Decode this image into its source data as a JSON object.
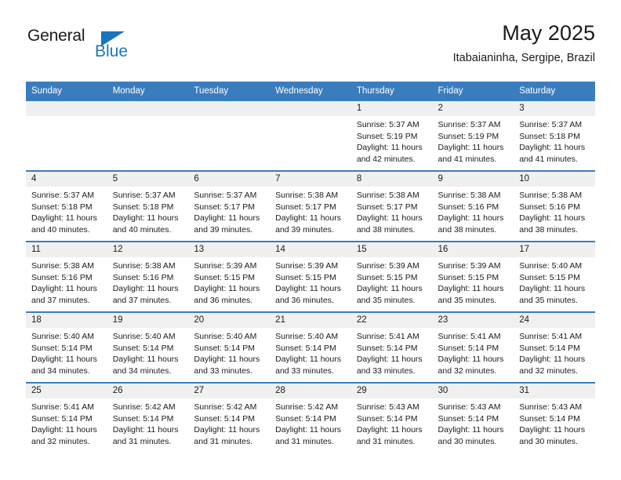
{
  "brand": {
    "name_top": "General",
    "name_bottom": "Blue",
    "accent_color": "#1a76bc",
    "triangle_icon": "triangle-icon"
  },
  "header": {
    "title": "May 2025",
    "subtitle": "Itabaianinha, Sergipe, Brazil"
  },
  "calendar": {
    "header_bg": "#3a7dbf",
    "daynum_bg": "#f0f0f0",
    "weekday_headers": [
      "Sunday",
      "Monday",
      "Tuesday",
      "Wednesday",
      "Thursday",
      "Friday",
      "Saturday"
    ],
    "weeks": [
      [
        {
          "day": "",
          "lines": []
        },
        {
          "day": "",
          "lines": []
        },
        {
          "day": "",
          "lines": []
        },
        {
          "day": "",
          "lines": []
        },
        {
          "day": "1",
          "lines": [
            "Sunrise: 5:37 AM",
            "Sunset: 5:19 PM",
            "Daylight: 11 hours",
            "and 42 minutes."
          ]
        },
        {
          "day": "2",
          "lines": [
            "Sunrise: 5:37 AM",
            "Sunset: 5:19 PM",
            "Daylight: 11 hours",
            "and 41 minutes."
          ]
        },
        {
          "day": "3",
          "lines": [
            "Sunrise: 5:37 AM",
            "Sunset: 5:18 PM",
            "Daylight: 11 hours",
            "and 41 minutes."
          ]
        }
      ],
      [
        {
          "day": "4",
          "lines": [
            "Sunrise: 5:37 AM",
            "Sunset: 5:18 PM",
            "Daylight: 11 hours",
            "and 40 minutes."
          ]
        },
        {
          "day": "5",
          "lines": [
            "Sunrise: 5:37 AM",
            "Sunset: 5:18 PM",
            "Daylight: 11 hours",
            "and 40 minutes."
          ]
        },
        {
          "day": "6",
          "lines": [
            "Sunrise: 5:37 AM",
            "Sunset: 5:17 PM",
            "Daylight: 11 hours",
            "and 39 minutes."
          ]
        },
        {
          "day": "7",
          "lines": [
            "Sunrise: 5:38 AM",
            "Sunset: 5:17 PM",
            "Daylight: 11 hours",
            "and 39 minutes."
          ]
        },
        {
          "day": "8",
          "lines": [
            "Sunrise: 5:38 AM",
            "Sunset: 5:17 PM",
            "Daylight: 11 hours",
            "and 38 minutes."
          ]
        },
        {
          "day": "9",
          "lines": [
            "Sunrise: 5:38 AM",
            "Sunset: 5:16 PM",
            "Daylight: 11 hours",
            "and 38 minutes."
          ]
        },
        {
          "day": "10",
          "lines": [
            "Sunrise: 5:38 AM",
            "Sunset: 5:16 PM",
            "Daylight: 11 hours",
            "and 38 minutes."
          ]
        }
      ],
      [
        {
          "day": "11",
          "lines": [
            "Sunrise: 5:38 AM",
            "Sunset: 5:16 PM",
            "Daylight: 11 hours",
            "and 37 minutes."
          ]
        },
        {
          "day": "12",
          "lines": [
            "Sunrise: 5:38 AM",
            "Sunset: 5:16 PM",
            "Daylight: 11 hours",
            "and 37 minutes."
          ]
        },
        {
          "day": "13",
          "lines": [
            "Sunrise: 5:39 AM",
            "Sunset: 5:15 PM",
            "Daylight: 11 hours",
            "and 36 minutes."
          ]
        },
        {
          "day": "14",
          "lines": [
            "Sunrise: 5:39 AM",
            "Sunset: 5:15 PM",
            "Daylight: 11 hours",
            "and 36 minutes."
          ]
        },
        {
          "day": "15",
          "lines": [
            "Sunrise: 5:39 AM",
            "Sunset: 5:15 PM",
            "Daylight: 11 hours",
            "and 35 minutes."
          ]
        },
        {
          "day": "16",
          "lines": [
            "Sunrise: 5:39 AM",
            "Sunset: 5:15 PM",
            "Daylight: 11 hours",
            "and 35 minutes."
          ]
        },
        {
          "day": "17",
          "lines": [
            "Sunrise: 5:40 AM",
            "Sunset: 5:15 PM",
            "Daylight: 11 hours",
            "and 35 minutes."
          ]
        }
      ],
      [
        {
          "day": "18",
          "lines": [
            "Sunrise: 5:40 AM",
            "Sunset: 5:14 PM",
            "Daylight: 11 hours",
            "and 34 minutes."
          ]
        },
        {
          "day": "19",
          "lines": [
            "Sunrise: 5:40 AM",
            "Sunset: 5:14 PM",
            "Daylight: 11 hours",
            "and 34 minutes."
          ]
        },
        {
          "day": "20",
          "lines": [
            "Sunrise: 5:40 AM",
            "Sunset: 5:14 PM",
            "Daylight: 11 hours",
            "and 33 minutes."
          ]
        },
        {
          "day": "21",
          "lines": [
            "Sunrise: 5:40 AM",
            "Sunset: 5:14 PM",
            "Daylight: 11 hours",
            "and 33 minutes."
          ]
        },
        {
          "day": "22",
          "lines": [
            "Sunrise: 5:41 AM",
            "Sunset: 5:14 PM",
            "Daylight: 11 hours",
            "and 33 minutes."
          ]
        },
        {
          "day": "23",
          "lines": [
            "Sunrise: 5:41 AM",
            "Sunset: 5:14 PM",
            "Daylight: 11 hours",
            "and 32 minutes."
          ]
        },
        {
          "day": "24",
          "lines": [
            "Sunrise: 5:41 AM",
            "Sunset: 5:14 PM",
            "Daylight: 11 hours",
            "and 32 minutes."
          ]
        }
      ],
      [
        {
          "day": "25",
          "lines": [
            "Sunrise: 5:41 AM",
            "Sunset: 5:14 PM",
            "Daylight: 11 hours",
            "and 32 minutes."
          ]
        },
        {
          "day": "26",
          "lines": [
            "Sunrise: 5:42 AM",
            "Sunset: 5:14 PM",
            "Daylight: 11 hours",
            "and 31 minutes."
          ]
        },
        {
          "day": "27",
          "lines": [
            "Sunrise: 5:42 AM",
            "Sunset: 5:14 PM",
            "Daylight: 11 hours",
            "and 31 minutes."
          ]
        },
        {
          "day": "28",
          "lines": [
            "Sunrise: 5:42 AM",
            "Sunset: 5:14 PM",
            "Daylight: 11 hours",
            "and 31 minutes."
          ]
        },
        {
          "day": "29",
          "lines": [
            "Sunrise: 5:43 AM",
            "Sunset: 5:14 PM",
            "Daylight: 11 hours",
            "and 31 minutes."
          ]
        },
        {
          "day": "30",
          "lines": [
            "Sunrise: 5:43 AM",
            "Sunset: 5:14 PM",
            "Daylight: 11 hours",
            "and 30 minutes."
          ]
        },
        {
          "day": "31",
          "lines": [
            "Sunrise: 5:43 AM",
            "Sunset: 5:14 PM",
            "Daylight: 11 hours",
            "and 30 minutes."
          ]
        }
      ]
    ]
  }
}
